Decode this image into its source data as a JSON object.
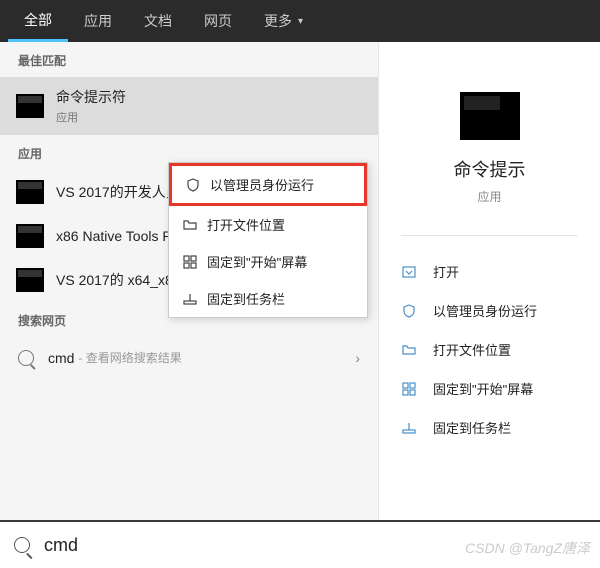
{
  "tabs": {
    "all": "全部",
    "apps": "应用",
    "docs": "文档",
    "web": "网页",
    "more": "更多"
  },
  "best_match_label": "最佳匹配",
  "best_match": {
    "title": "命令提示符",
    "subtitle": "应用"
  },
  "apps_label": "应用",
  "app_results": [
    {
      "title": "VS 2017的开发人员"
    },
    {
      "title": "x86 Native Tools Prompt for VS 2017"
    },
    {
      "title": "VS 2017的 x64_x86 交叉工具命令提示符"
    }
  ],
  "web_label": "搜索网页",
  "web": {
    "query": "cmd",
    "hint": "- 查看网络搜索结果"
  },
  "context": {
    "run_admin": "以管理员身份运行",
    "open_location": "打开文件位置",
    "pin_start": "固定到\"开始\"屏幕",
    "pin_taskbar": "固定到任务栏"
  },
  "preview": {
    "title": "命令提示",
    "subtitle": "应用"
  },
  "actions": {
    "open": "打开",
    "run_admin": "以管理员身份运行",
    "open_location": "打开文件位置",
    "pin_start": "固定到\"开始\"屏幕",
    "pin_taskbar": "固定到任务栏"
  },
  "search_value": "cmd",
  "watermark": "CSDN @TangZ唐泽"
}
